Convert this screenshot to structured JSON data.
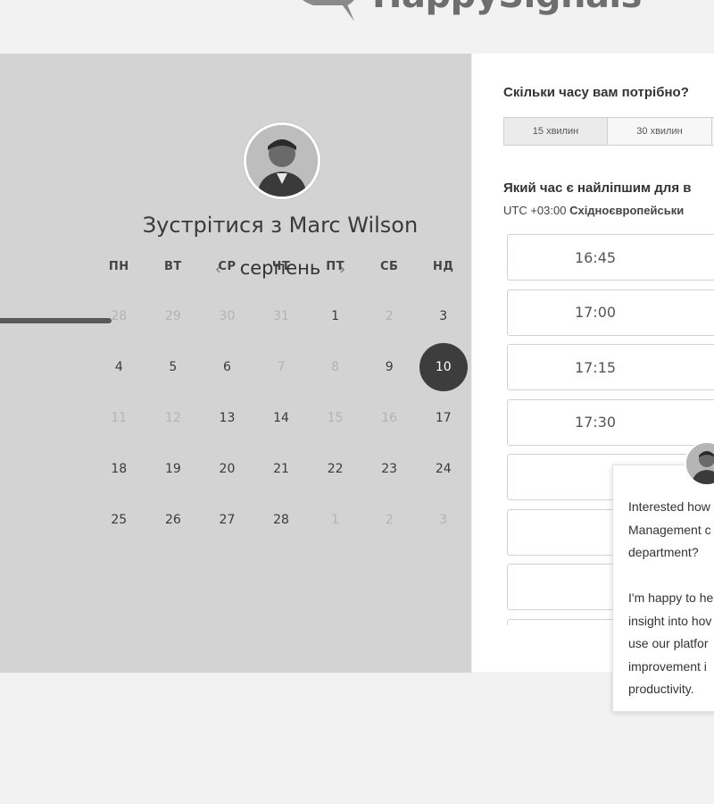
{
  "header": {
    "logo_text": "HappySignals"
  },
  "calendar": {
    "title": "Зустрітися з Marc Wilson",
    "month": "серпень",
    "prev_arrow": "‹",
    "next_arrow": "›",
    "weekdays": [
      "ПН",
      "ВТ",
      "СР",
      "ЧТ",
      "ПТ",
      "СБ",
      "НД"
    ],
    "weeks": [
      [
        {
          "d": "28",
          "m": true
        },
        {
          "d": "29",
          "m": true
        },
        {
          "d": "30",
          "m": true
        },
        {
          "d": "31",
          "m": true
        },
        {
          "d": "1",
          "m": false
        },
        {
          "d": "2",
          "m": true
        },
        {
          "d": "3",
          "m": false
        }
      ],
      [
        {
          "d": "4",
          "m": false
        },
        {
          "d": "5",
          "m": false
        },
        {
          "d": "6",
          "m": false
        },
        {
          "d": "7",
          "m": true
        },
        {
          "d": "8",
          "m": true
        },
        {
          "d": "9",
          "m": false
        },
        {
          "d": "10",
          "m": false,
          "s": true
        }
      ],
      [
        {
          "d": "11",
          "m": true
        },
        {
          "d": "12",
          "m": true
        },
        {
          "d": "13",
          "m": false
        },
        {
          "d": "14",
          "m": false
        },
        {
          "d": "15",
          "m": true
        },
        {
          "d": "16",
          "m": true
        },
        {
          "d": "17",
          "m": false
        }
      ],
      [
        {
          "d": "18",
          "m": false
        },
        {
          "d": "19",
          "m": false
        },
        {
          "d": "20",
          "m": false
        },
        {
          "d": "21",
          "m": false
        },
        {
          "d": "22",
          "m": false
        },
        {
          "d": "23",
          "m": false
        },
        {
          "d": "24",
          "m": false
        }
      ],
      [
        {
          "d": "25",
          "m": false
        },
        {
          "d": "26",
          "m": false
        },
        {
          "d": "27",
          "m": false
        },
        {
          "d": "28",
          "m": false
        },
        {
          "d": "1",
          "m": true
        },
        {
          "d": "2",
          "m": true
        },
        {
          "d": "3",
          "m": true
        }
      ]
    ]
  },
  "scheduler": {
    "duration_question": "Скільки часу вам потрібно?",
    "durations": [
      "15 хвилин",
      "30 хвилин",
      ""
    ],
    "time_question": "Який час є найліпшим для в",
    "tz_offset": "UTC +03:00",
    "tz_name": "Східноєвропейськи",
    "slots": [
      "16:45",
      "17:00",
      "17:15",
      "17:30",
      "",
      "",
      "",
      ""
    ]
  },
  "chat": {
    "message": "Interested how\nManagement c\ndepartment?\n\nI'm happy to he\ninsight into hov\nuse our platfor\nimprovement i\nproductivity."
  }
}
